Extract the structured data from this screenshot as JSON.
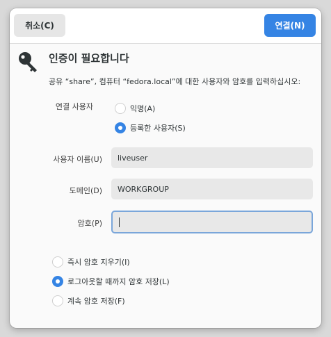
{
  "header": {
    "cancel_label": "취소(C)",
    "connect_label": "연결(N)"
  },
  "title": "인증이 필요합니다",
  "message": "공유 “share”, 컴퓨터 “fedora.local”에 대한 사용자와 암호를 입력하십시오:",
  "connect_as": {
    "label": "연결 사용자",
    "options": [
      {
        "label": "익명(A)",
        "checked": false
      },
      {
        "label": "등록한 사용자(S)",
        "checked": true
      }
    ]
  },
  "username": {
    "label": "사용자 이름(U)",
    "value": "liveuser"
  },
  "domain": {
    "label": "도메인(D)",
    "value": "WORKGROUP"
  },
  "password": {
    "label": "암호(P)",
    "value": ""
  },
  "remember": {
    "options": [
      {
        "label": "즉시 암호 지우기(I)",
        "checked": false
      },
      {
        "label": "로그아웃할 때까지 암호 저장(L)",
        "checked": true
      },
      {
        "label": "계속 암호 저장(F)",
        "checked": false
      }
    ]
  },
  "colors": {
    "accent": "#3584e4",
    "entry_bg": "#e8e8e8",
    "focus": "#7aa6da"
  },
  "icons": {
    "dialog_icon": "key-icon"
  }
}
